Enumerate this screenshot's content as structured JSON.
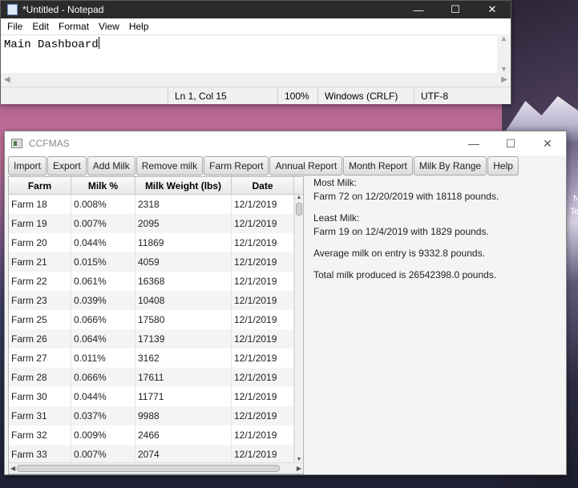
{
  "desktop": {
    "right_text_1": "N",
    "right_text_2": "Te"
  },
  "notepad": {
    "title": "*Untitled - Notepad",
    "menu": [
      "File",
      "Edit",
      "Format",
      "View",
      "Help"
    ],
    "content": "Main Dashboard",
    "status": {
      "position": "Ln 1, Col 15",
      "zoom": "100%",
      "line_endings": "Windows (CRLF)",
      "encoding": "UTF-8"
    }
  },
  "ccfmas": {
    "title": "CCFMAS",
    "toolbar": [
      "Import",
      "Export",
      "Add Milk",
      "Remove milk",
      "Farm Report",
      "Annual Report",
      "Month Report",
      "Milk By Range",
      "Help"
    ],
    "columns": [
      "Farm",
      "Milk %",
      "Milk Weight (lbs)",
      "Date"
    ],
    "rows": [
      [
        "Farm 18",
        "0.008%",
        "2318",
        "12/1/2019"
      ],
      [
        "Farm 19",
        "0.007%",
        "2095",
        "12/1/2019"
      ],
      [
        "Farm 20",
        "0.044%",
        "11869",
        "12/1/2019"
      ],
      [
        "Farm 21",
        "0.015%",
        "4059",
        "12/1/2019"
      ],
      [
        "Farm 22",
        "0.061%",
        "16368",
        "12/1/2019"
      ],
      [
        "Farm 23",
        "0.039%",
        "10408",
        "12/1/2019"
      ],
      [
        "Farm 25",
        "0.066%",
        "17580",
        "12/1/2019"
      ],
      [
        "Farm 26",
        "0.064%",
        "17139",
        "12/1/2019"
      ],
      [
        "Farm 27",
        "0.011%",
        "3162",
        "12/1/2019"
      ],
      [
        "Farm 28",
        "0.066%",
        "17611",
        "12/1/2019"
      ],
      [
        "Farm 30",
        "0.044%",
        "11771",
        "12/1/2019"
      ],
      [
        "Farm 31",
        "0.037%",
        "9988",
        "12/1/2019"
      ],
      [
        "Farm 32",
        "0.009%",
        "2466",
        "12/1/2019"
      ],
      [
        "Farm 33",
        "0.007%",
        "2074",
        "12/1/2019"
      ]
    ],
    "info": {
      "most_label": "Most Milk:",
      "most_value": "Farm 72 on 12/20/2019 with 18118 pounds.",
      "least_label": "Least Milk:",
      "least_value": "Farm 19 on 12/4/2019 with 1829 pounds.",
      "average": "Average milk on entry is 9332.8 pounds.",
      "total": "Total milk produced is 26542398.0 pounds."
    }
  }
}
